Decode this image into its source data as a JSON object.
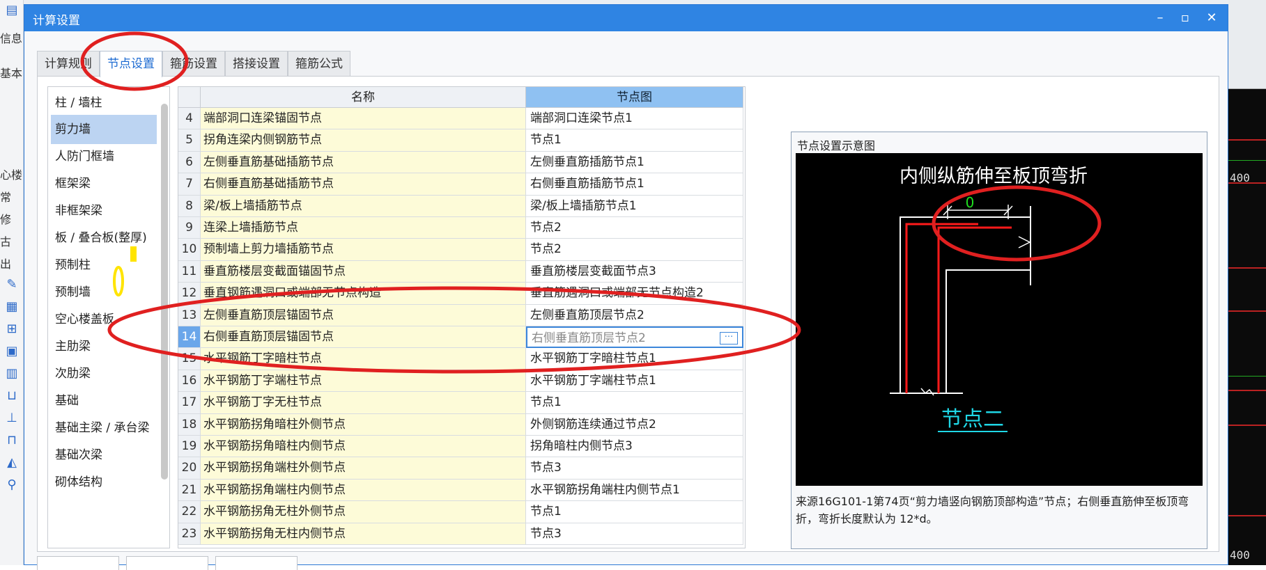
{
  "window": {
    "title": "计算设置",
    "minimize": "–",
    "maximize": "▫",
    "close": "✕"
  },
  "tabs": [
    {
      "label": "计算规则"
    },
    {
      "label": "节点设置"
    },
    {
      "label": "箍筋设置"
    },
    {
      "label": "搭接设置"
    },
    {
      "label": "箍筋公式"
    }
  ],
  "background_left": {
    "texts": [
      "信息",
      "基本",
      "心楼",
      "常",
      "修",
      "古",
      "出"
    ]
  },
  "categories": [
    "柱 / 墙柱",
    "剪力墙",
    "人防门框墙",
    "框架梁",
    "非框架梁",
    "板 / 叠合板(整厚)",
    "预制柱",
    "预制墙",
    "空心楼盖板",
    "主肋梁",
    "次肋梁",
    "基础",
    "基础主梁 / 承台梁",
    "基础次梁",
    "砌体结构"
  ],
  "table": {
    "headers": {
      "name": "名称",
      "node": "节点图"
    },
    "rows": [
      {
        "num": "4",
        "name": "端部洞口连梁锚固节点",
        "node": "端部洞口连梁节点1"
      },
      {
        "num": "5",
        "name": "拐角连梁内侧钢筋节点",
        "node": "节点1"
      },
      {
        "num": "6",
        "name": "左侧垂直筋基础插筋节点",
        "node": "左侧垂直筋插筋节点1"
      },
      {
        "num": "7",
        "name": "右侧垂直筋基础插筋节点",
        "node": "右侧垂直筋插筋节点1"
      },
      {
        "num": "8",
        "name": "梁/板上墙插筋节点",
        "node": "梁/板上墙插筋节点1"
      },
      {
        "num": "9",
        "name": "连梁上墙插筋节点",
        "node": "节点2"
      },
      {
        "num": "10",
        "name": "预制墙上剪力墙插筋节点",
        "node": "节点2"
      },
      {
        "num": "11",
        "name": "垂直筋楼层变截面锚固节点",
        "node": "垂直筋楼层变截面节点3"
      },
      {
        "num": "12",
        "name": "垂直钢筋遇洞口或端部无节点构造",
        "node": "垂直筋遇洞口或端部无节点构造2"
      },
      {
        "num": "13",
        "name": "左侧垂直筋顶层锚固节点",
        "node": "左侧垂直筋顶层节点2"
      },
      {
        "num": "14",
        "name": "右侧垂直筋顶层锚固节点",
        "node": "右侧垂直筋顶层节点2"
      },
      {
        "num": "15",
        "name": "水平钢筋丁字暗柱节点",
        "node": "水平钢筋丁字暗柱节点1"
      },
      {
        "num": "16",
        "name": "水平钢筋丁字端柱节点",
        "node": "水平钢筋丁字端柱节点1"
      },
      {
        "num": "17",
        "name": "水平钢筋丁字无柱节点",
        "node": "节点1"
      },
      {
        "num": "18",
        "name": "水平钢筋拐角暗柱外侧节点",
        "node": "外侧钢筋连续通过节点2"
      },
      {
        "num": "19",
        "name": "水平钢筋拐角暗柱内侧节点",
        "node": "拐角暗柱内侧节点3"
      },
      {
        "num": "20",
        "name": "水平钢筋拐角端柱外侧节点",
        "node": "节点3"
      },
      {
        "num": "21",
        "name": "水平钢筋拐角端柱内侧节点",
        "node": "水平钢筋拐角端柱内侧节点1"
      },
      {
        "num": "22",
        "name": "水平钢筋拐角无柱外侧节点",
        "node": "节点1"
      },
      {
        "num": "23",
        "name": "水平钢筋拐角无柱内侧节点",
        "node": "节点3"
      }
    ],
    "selected_row": "14",
    "more_button": "···"
  },
  "diagram": {
    "caption": "节点设置示意图",
    "heading": "内侧纵筋伸至板顶弯折",
    "dimension_value": "0",
    "node_name": "节点二",
    "description": "来源16G101-1第74页“剪力墙竖向钢筋顶部构造”节点；右侧垂直筋伸至板顶弯折，弯折长度默认为 12*d。"
  },
  "background_right": {
    "numbers": [
      "400",
      "400"
    ]
  },
  "colors": {
    "accent": "#2f84e3",
    "annotation_red": "#e02020",
    "annotation_yellow": "#ffe400",
    "rebar_red": "#ff1a1a",
    "dimension_green": "#20e020",
    "node_label_cyan": "#1fd7e6"
  }
}
